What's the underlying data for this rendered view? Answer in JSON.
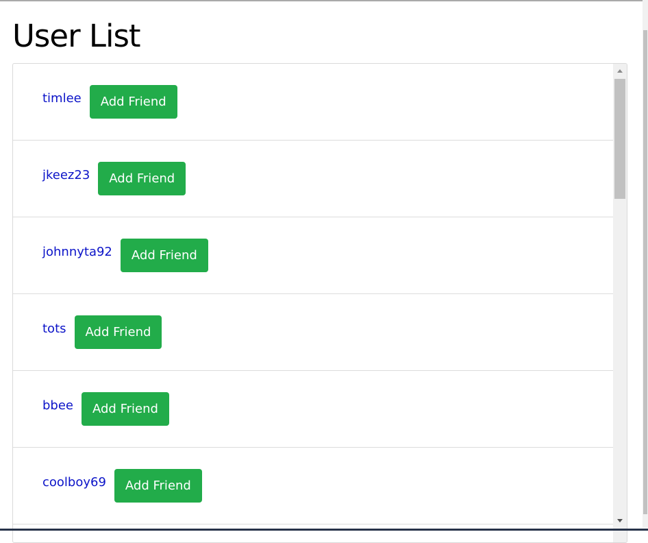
{
  "page": {
    "title": "User List"
  },
  "users": [
    {
      "username": "timlee",
      "action_label": "Add Friend"
    },
    {
      "username": "jkeez23",
      "action_label": "Add Friend"
    },
    {
      "username": "johnnyta92",
      "action_label": "Add Friend"
    },
    {
      "username": "tots",
      "action_label": "Add Friend"
    },
    {
      "username": "bbee",
      "action_label": "Add Friend"
    },
    {
      "username": "coolboy69",
      "action_label": "Add Friend"
    }
  ],
  "colors": {
    "link": "#0b13c8",
    "button": "#22ac4a",
    "button_text": "#ffffff"
  },
  "icons": {
    "scroll_up": "chevron-up-icon",
    "scroll_down": "chevron-down-icon"
  }
}
